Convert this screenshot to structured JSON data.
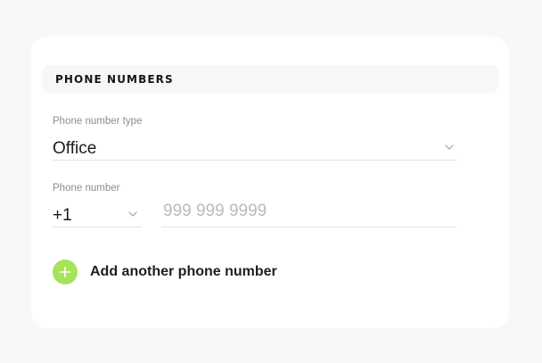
{
  "section": {
    "title": "PHONE NUMBERS"
  },
  "phone_type": {
    "label": "Phone number type",
    "value": "Office"
  },
  "phone_number": {
    "label": "Phone number",
    "country_code": "+1",
    "value": "",
    "placeholder": "999 999 9999"
  },
  "add_action": {
    "label": "Add another phone number",
    "icon": "plus-icon",
    "accent_color": "#a6e25a"
  },
  "icons": {
    "dropdown": "chevron-down-icon"
  }
}
